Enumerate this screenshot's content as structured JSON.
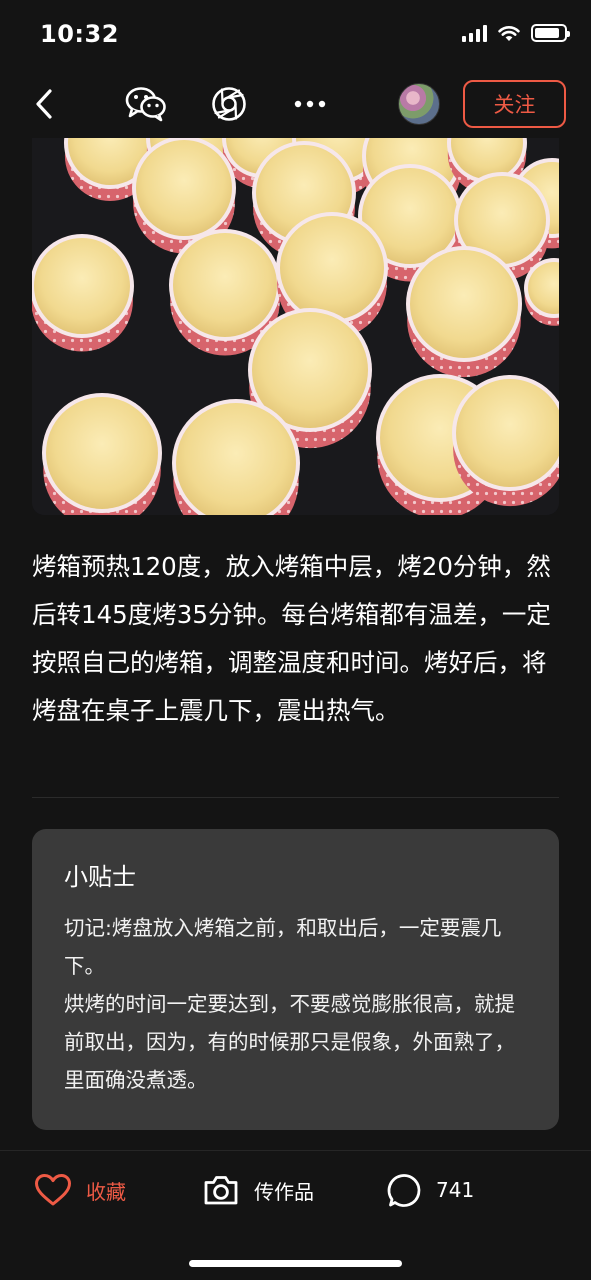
{
  "status_bar": {
    "time": "10:32",
    "icons": [
      "signal-icon",
      "wifi-icon",
      "battery-icon"
    ],
    "battery_level": 0.85
  },
  "nav": {
    "icons": [
      "back-icon",
      "wechat-icon",
      "moments-icon",
      "more-icon"
    ],
    "follow_label": "关注"
  },
  "photo": {
    "subject": "cupcake-photo"
  },
  "step": {
    "text": "烤箱预热120度，放入烤箱中层，烤20分钟，然后转145度烤35分钟。每台烤箱都有温差，一定按照自己的烤箱，调整温度和时间。烤好后，将烤盘在桌子上震几下，震出热气。"
  },
  "tips": {
    "title": "小贴士",
    "lines": [
      "切记:烤盘放入烤箱之前，和取出后，一定要震几下。",
      "烘烤的时间一定要达到，不要感觉膨胀很高，就提前取出，因为，有的时候那只是假象，外面熟了，里面确没煮透。"
    ]
  },
  "bottom_bar": {
    "favorite_label": "收藏",
    "upload_label": "传作品",
    "comment_count": "741"
  },
  "colors": {
    "background": "#141414",
    "accent": "#ee5a45",
    "card": "#3a3a3a",
    "text": "#ffffff"
  }
}
